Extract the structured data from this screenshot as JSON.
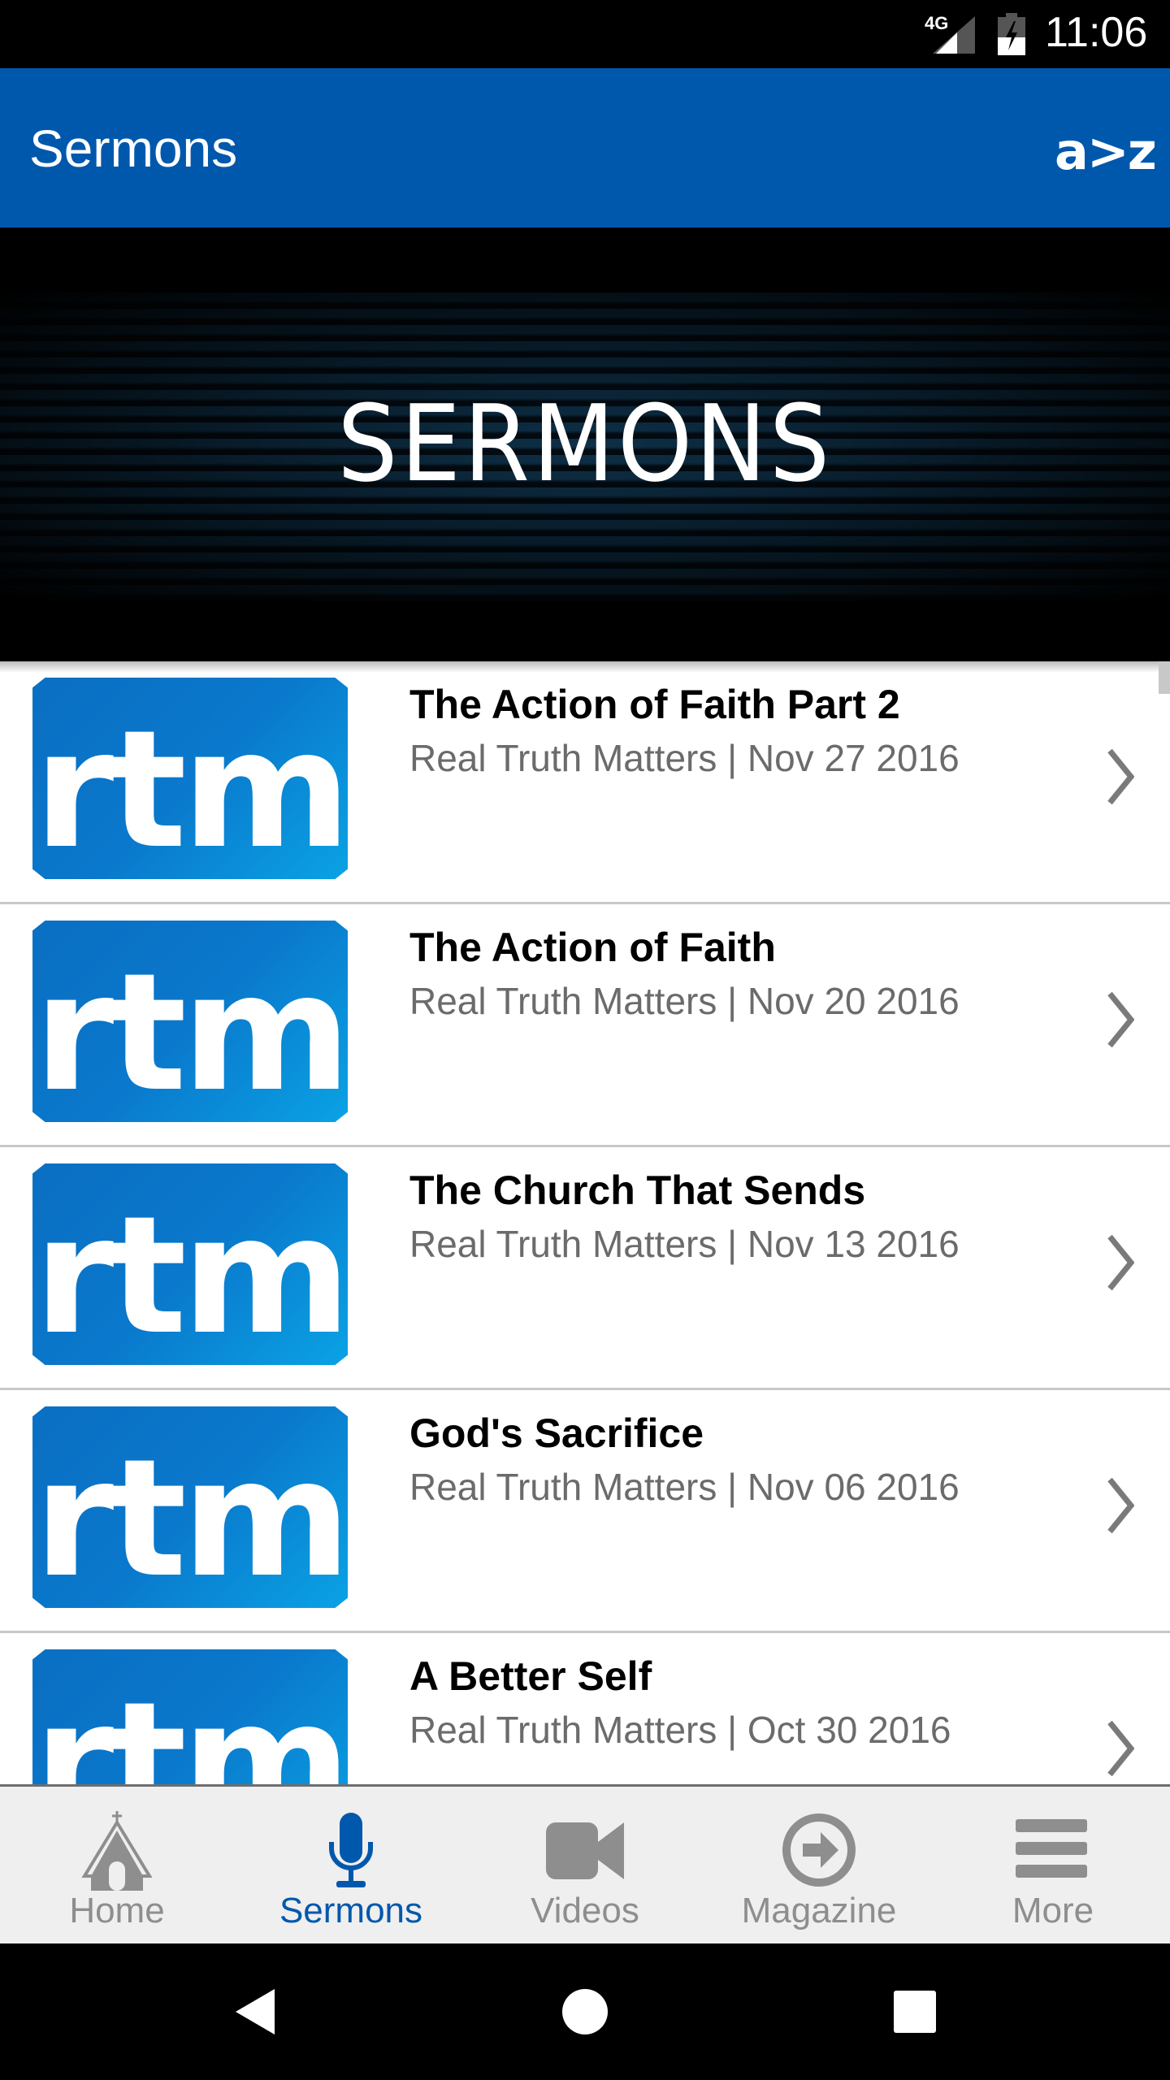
{
  "status_bar": {
    "network": "4G",
    "signal_icon": "signal-icon",
    "battery_icon": "battery-charging-icon",
    "time": "11:06"
  },
  "app_bar": {
    "title": "Sermons",
    "logo_text": "a>z",
    "accent_color": "#0058ac"
  },
  "banner": {
    "text": "SERMONS"
  },
  "sermons": [
    {
      "thumb_text": "rtm",
      "title": "The Action of Faith Part 2",
      "subtitle": "Real Truth Matters | Nov 27 2016"
    },
    {
      "thumb_text": "rtm",
      "title": "The Action of Faith",
      "subtitle": "Real Truth Matters | Nov 20 2016"
    },
    {
      "thumb_text": "rtm",
      "title": "The Church That Sends",
      "subtitle": "Real Truth Matters | Nov 13 2016"
    },
    {
      "thumb_text": "rtm",
      "title": "God's Sacrifice",
      "subtitle": "Real Truth Matters | Nov 06 2016"
    },
    {
      "thumb_text": "rtm",
      "title": "A Better Self",
      "subtitle": "Real Truth Matters | Oct 30 2016"
    }
  ],
  "tabs": [
    {
      "label": "Home",
      "icon": "church-icon",
      "active": false
    },
    {
      "label": "Sermons",
      "icon": "microphone-icon",
      "active": true
    },
    {
      "label": "Videos",
      "icon": "video-camera-icon",
      "active": false
    },
    {
      "label": "Magazine",
      "icon": "arrow-circle-icon",
      "active": false
    },
    {
      "label": "More",
      "icon": "menu-icon",
      "active": false
    }
  ],
  "nav_buttons": [
    "back",
    "home",
    "recents"
  ]
}
